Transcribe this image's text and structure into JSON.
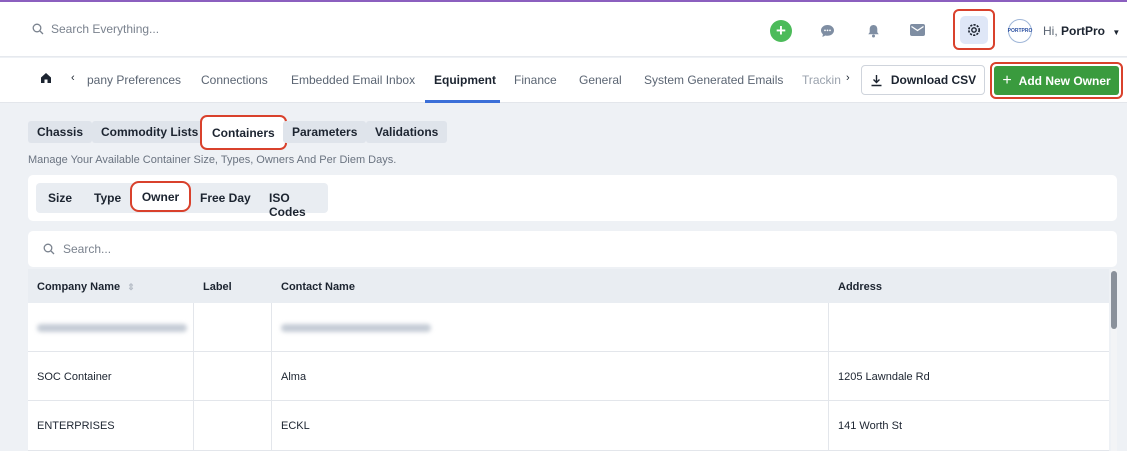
{
  "header": {
    "search_placeholder": "Search Everything...",
    "greeting": "Hi, ",
    "user_name": "PortPro",
    "avatar_text": "PORTPRO"
  },
  "tabs": [
    {
      "label": "pany Preferences"
    },
    {
      "label": "Connections"
    },
    {
      "label": "Embedded Email Inbox"
    },
    {
      "label": "Equipment"
    },
    {
      "label": "Finance"
    },
    {
      "label": "General"
    },
    {
      "label": "System Generated Emails"
    },
    {
      "label": "Trackin"
    }
  ],
  "actions": {
    "download_csv": "Download CSV",
    "add_new_owner": "Add New Owner"
  },
  "equipment_tabs": [
    {
      "label": "Chassis"
    },
    {
      "label": "Commodity Lists"
    },
    {
      "label": "Containers"
    },
    {
      "label": "Parameters"
    },
    {
      "label": "Validations"
    }
  ],
  "description": "Manage Your Available Container Size, Types, Owners And Per Diem Days.",
  "container_tabs": [
    {
      "label": "Size"
    },
    {
      "label": "Type"
    },
    {
      "label": "Owner"
    },
    {
      "label": "Free Day"
    },
    {
      "label": "ISO Codes"
    }
  ],
  "table": {
    "search_placeholder": "Search...",
    "columns": [
      "Company Name",
      "Label",
      "Contact Name",
      "Address"
    ],
    "rows": [
      {
        "company": "",
        "label": "",
        "contact": "",
        "address": ""
      },
      {
        "company": "SOC Container",
        "label": "",
        "contact": "Alma",
        "address": "1205 Lawndale Rd"
      },
      {
        "company": "ENTERPRISES",
        "label": "",
        "contact": "ECKL",
        "address": "141 Worth St"
      }
    ]
  },
  "colors": {
    "accent": "#3b6fd8",
    "primary_green": "#3a9b3e",
    "highlight": "#d9412c"
  }
}
